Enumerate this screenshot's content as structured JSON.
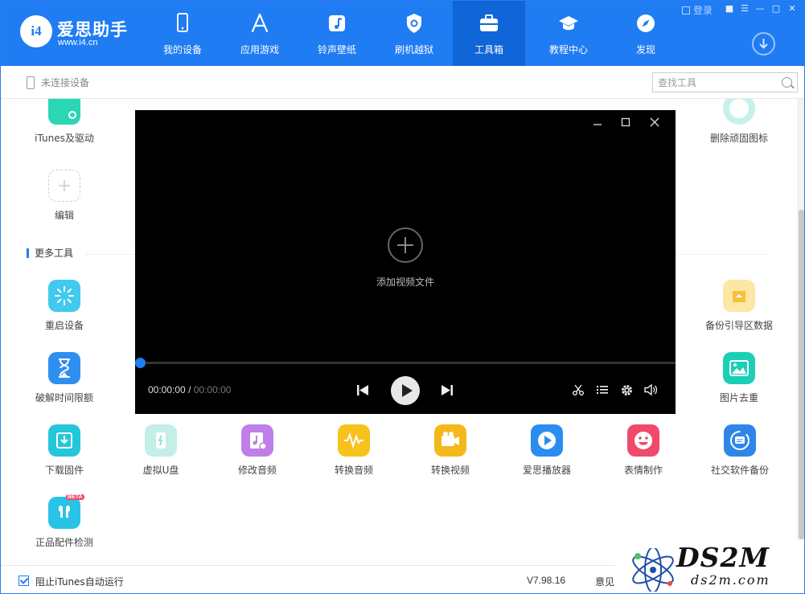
{
  "brand": {
    "name": "爱思助手",
    "url": "www.i4.cn",
    "mark": "i4"
  },
  "nav": [
    {
      "label": "我的设备",
      "icon": "phone-icon"
    },
    {
      "label": "应用游戏",
      "icon": "app-store-icon"
    },
    {
      "label": "铃声壁纸",
      "icon": "music-note-icon"
    },
    {
      "label": "刷机越狱",
      "icon": "shield-icon"
    },
    {
      "label": "工具箱",
      "icon": "toolbox-icon",
      "active": true
    },
    {
      "label": "教程中心",
      "icon": "graduation-cap-icon"
    },
    {
      "label": "发现",
      "icon": "compass-icon"
    }
  ],
  "window": {
    "login": "登录"
  },
  "subbar": {
    "device_status": "未连接设备",
    "search_placeholder": "查找工具"
  },
  "tools_top": [
    {
      "label": "iTunes及驱动",
      "color": "#2bd6b5",
      "icon": "itunes-driver-icon"
    },
    {
      "label": "删除顽固图标",
      "color": "#7fe0d2",
      "icon": "delete-icon"
    }
  ],
  "edit": {
    "label": "编辑",
    "icon": "plus-icon"
  },
  "section": {
    "title": "更多工具"
  },
  "tools_more": [
    {
      "label": "重启设备",
      "color": "#41c9f0",
      "icon": "restart-icon"
    },
    {
      "label": "备份引导区数据",
      "color": "#f5c13a",
      "icon": "backup-boot-icon"
    },
    {
      "label": "破解时间限额",
      "color": "#2e8ff0",
      "icon": "hourglass-icon"
    },
    {
      "label": "图片去重",
      "color": "#1bcfb6",
      "icon": "image-icon"
    }
  ],
  "tools_row": [
    {
      "label": "下载固件",
      "color": "#23c7d9",
      "icon": "download-firmware-icon"
    },
    {
      "label": "虚拟U盘",
      "color": "#86e0cf",
      "icon": "usb-drive-icon"
    },
    {
      "label": "修改音频",
      "color": "#c07ee8",
      "icon": "audio-edit-icon"
    },
    {
      "label": "转换音频",
      "color": "#f7c21c",
      "icon": "audio-wave-icon"
    },
    {
      "label": "转换视频",
      "color": "#f5b81a",
      "icon": "video-camera-icon"
    },
    {
      "label": "爱思播放器",
      "color": "#2a8df0",
      "icon": "play-circle-icon"
    },
    {
      "label": "表情制作",
      "color": "#f04a6a",
      "icon": "smile-icon"
    },
    {
      "label": "社交软件备份",
      "color": "#2f86e8",
      "icon": "chat-backup-icon"
    }
  ],
  "tool_last": {
    "label": "正品配件检测",
    "color": "#2bc2e8",
    "icon": "earphones-icon",
    "badge": "BETA"
  },
  "player": {
    "add_label": "添加视频文件",
    "current_time": "00:00:00",
    "separator": "/",
    "duration": "00:00:00",
    "progress": 0
  },
  "footer": {
    "checkbox_label": "阻止iTunes自动运行",
    "checked": true,
    "version": "V7.98.16",
    "feedback": "意见"
  },
  "watermark": {
    "text": "DS2M",
    "sub": "ds2m.com"
  }
}
